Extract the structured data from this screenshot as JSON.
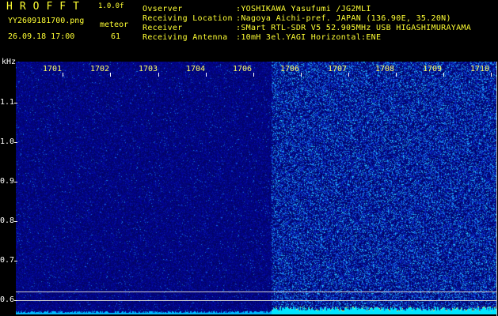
{
  "header": {
    "brand": "HROFFT",
    "version": "1.0.0f",
    "filename": "YY2609181700.png",
    "datetime": "26.09.18 17:00",
    "meteor_label": "meteor",
    "meteor_count": "61"
  },
  "station_info": [
    {
      "key": "Ovserver",
      "value": ":YOSHIKAWA Yasufumi /JG2MLI"
    },
    {
      "key": "Receiving Location",
      "value": ":Nagoya Aichi-pref. JAPAN (136.90E, 35.20N)"
    },
    {
      "key": "Receiver",
      "value": ":SMart RTL-SDR V5 52.905MHz USB HIGASHIMURAYAMA"
    },
    {
      "key": "Receiving Antenna",
      "value": ":10mH 3el.YAGI Horizontal:ENE"
    }
  ],
  "axis": {
    "y_unit": "kHz",
    "y_ticks": [
      "1.1",
      "1.0",
      "0.9",
      "0.8",
      "0.7",
      "0.6"
    ],
    "x_ticks": [
      "1701",
      "1702",
      "1703",
      "1704",
      "1706",
      "1706",
      "1707",
      "1708",
      "1709",
      "1710"
    ]
  },
  "colors": {
    "background": "#000000",
    "label_yellow": "#ffff33",
    "spectrum_base": "#02047a",
    "noise_bright": "#2fd0ff",
    "bottom_trace": "#00e5ff"
  }
}
